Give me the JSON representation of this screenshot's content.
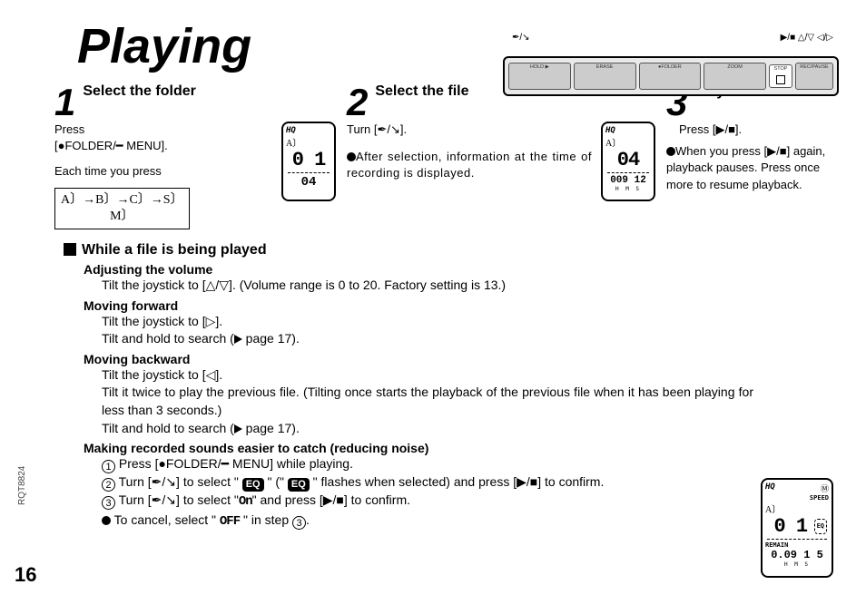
{
  "title": "Playing",
  "page_number": "16",
  "page_code": "RQT8824",
  "device": {
    "top_labels": [
      "✒/↘",
      "▶/■   △/▽   ◁/▷"
    ],
    "buttons": [
      "HOLD ▶",
      "ERASE",
      "●FOLDER",
      "ZOOM",
      "STOP",
      "REC/PAUSE"
    ]
  },
  "step1": {
    "num": "1",
    "title": "Select the folder",
    "body1": "Press\n[●FOLDER/━ MENU].",
    "body2": "Each time you press",
    "sequence_line1": "A〕→B〕→C〕→S〕",
    "sequence_line2": "M〕",
    "lcd": {
      "hq": "HQ",
      "aj": "A〕",
      "main": "0 1",
      "sub": "04"
    }
  },
  "step2": {
    "num": "2",
    "title": "Select the file",
    "body1": "Turn [✒/↘].",
    "bullet": "After selection, information at the time of recording is displayed.",
    "lcd": {
      "hq": "HQ",
      "aj": "A〕",
      "main": "04",
      "sub": "009 12",
      "hms": "H   M   S"
    }
  },
  "step3": {
    "num": "3",
    "title": "Play",
    "body1": "Press [▶/■].",
    "bullet": "When you press [▶/■] again, playback pauses. Press once more to resume playback."
  },
  "section": {
    "header": "While a file is being played",
    "adj_vol_title": "Adjusting the volume",
    "adj_vol_body": "Tilt the joystick to [△/▽]. (Volume range is 0 to 20. Factory setting is 13.)",
    "fwd_title": "Moving forward",
    "fwd_l1": "Tilt the joystick to [▷].",
    "fwd_l2_a": "Tilt and hold to search (",
    "fwd_l2_b": " page 17).",
    "bwd_title": "Moving backward",
    "bwd_l1": "Tilt the joystick to [◁].",
    "bwd_l2": "Tilt it twice to play the previous file. (Tilting once starts the playback of the previous file when it has been playing for less than 3 seconds.)",
    "bwd_l3_a": "Tilt and hold to search (",
    "bwd_l3_b": " page 17).",
    "noise_title": "Making recorded sounds easier to catch (reducing noise)",
    "noise_1": "Press [●FOLDER/━ MENU] while playing.",
    "noise_2_a": "Turn [✒/↘] to select \" ",
    "noise_2_eq1": "EQ",
    "noise_2_b": " \" (\" ",
    "noise_2_eq2": "EQ",
    "noise_2_c": " \" flashes when selected) and press [▶/■] to confirm.",
    "noise_3_a": "Turn [✒/↘] to select \"",
    "noise_3_on_seg": "On",
    "noise_3_b": "\" and press [▶/■] to confirm.",
    "cancel_a": "To cancel, select \" ",
    "cancel_off_seg": "OFF",
    "cancel_b": " \" in step ",
    "cancel_c": "."
  },
  "remain_lcd": {
    "hq": "HQ",
    "m_icon": "Ⓜ",
    "speed": "SPEED",
    "aj": "A〕",
    "main": "0 1",
    "eq": "EQ",
    "remain": "REMAIN",
    "sub": "0.09 1 5",
    "hms": "H   M   S"
  }
}
